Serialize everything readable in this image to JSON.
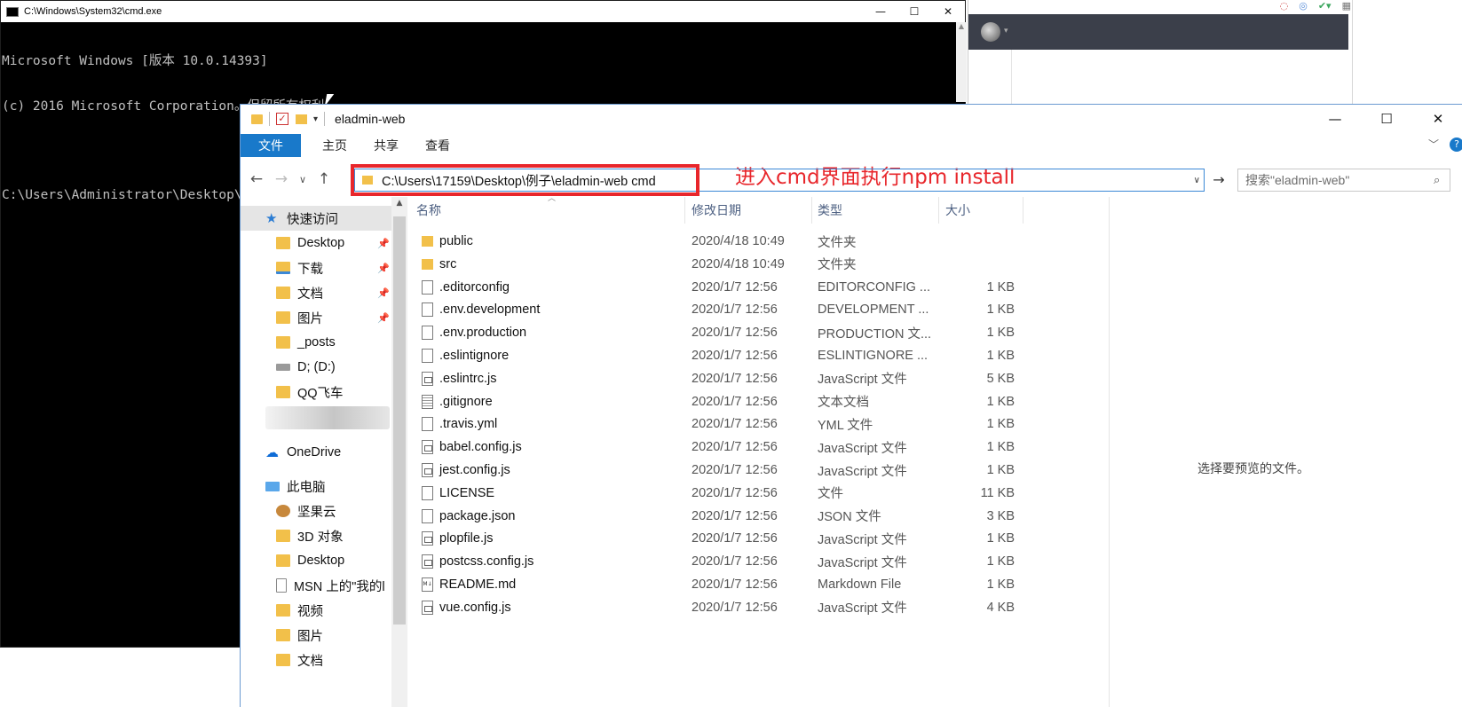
{
  "cmd": {
    "title": "C:\\Windows\\System32\\cmd.exe",
    "lines": [
      "Microsoft Windows [版本 10.0.14393]",
      "(c) 2016 Microsoft Corporation。保留所有权利。",
      "C:\\Users\\Administrator\\Desktop\\直播笔记\\项目\\eladmin-web>npm install"
    ],
    "controls": {
      "minimize": "—",
      "maximize": "☐",
      "close": "✕"
    }
  },
  "explorer": {
    "title": "eladmin-web",
    "controls": {
      "minimize": "—",
      "maximize": "☐",
      "close": "✕"
    },
    "ribbon": {
      "file": "文件",
      "tabs": [
        "主页",
        "共享",
        "查看"
      ]
    },
    "annotation": "进入cmd界面执行npm install",
    "address": "C:\\Users\\17159\\Desktop\\例子\\eladmin-web cmd",
    "search_placeholder": "搜索\"eladmin-web\"",
    "nav": [
      {
        "label": "快速访问",
        "icon": "star-icon",
        "pinned": false
      },
      {
        "label": "Desktop",
        "icon": "folder-icon",
        "pinned": true
      },
      {
        "label": "下载",
        "icon": "download-folder-icon",
        "pinned": true
      },
      {
        "label": "文档",
        "icon": "documents-folder-icon",
        "pinned": true
      },
      {
        "label": "图片",
        "icon": "pictures-folder-icon",
        "pinned": true
      },
      {
        "label": "_posts",
        "icon": "folder-icon",
        "pinned": false
      },
      {
        "label": "D; (D:)",
        "icon": "drive-icon",
        "pinned": false
      },
      {
        "label": "QQ飞车",
        "icon": "folder-icon",
        "pinned": false
      },
      {
        "label": "OneDrive",
        "icon": "onedrive-cloud-icon",
        "pinned": false
      },
      {
        "label": "此电脑",
        "icon": "this-pc-icon",
        "pinned": false
      },
      {
        "label": "坚果云",
        "icon": "nutstore-icon",
        "pinned": false
      },
      {
        "label": "3D 对象",
        "icon": "3d-objects-folder-icon",
        "pinned": false
      },
      {
        "label": "Desktop",
        "icon": "folder-icon",
        "pinned": false
      },
      {
        "label": "MSN 上的\"我的l",
        "icon": "document-icon",
        "pinned": false
      },
      {
        "label": "视频",
        "icon": "videos-folder-icon",
        "pinned": false
      },
      {
        "label": "图片",
        "icon": "pictures-folder-icon",
        "pinned": false
      },
      {
        "label": "文档",
        "icon": "documents-folder-icon",
        "pinned": false
      }
    ],
    "columns": {
      "name": "名称",
      "date": "修改日期",
      "type": "类型",
      "size": "大小"
    },
    "files": [
      {
        "name": "public",
        "date": "2020/4/18 10:49",
        "type": "文件夹",
        "size": "",
        "icon": "folder"
      },
      {
        "name": "src",
        "date": "2020/4/18 10:49",
        "type": "文件夹",
        "size": "",
        "icon": "folder"
      },
      {
        "name": ".editorconfig",
        "date": "2020/1/7 12:56",
        "type": "EDITORCONFIG ...",
        "size": "1 KB",
        "icon": "file"
      },
      {
        "name": ".env.development",
        "date": "2020/1/7 12:56",
        "type": "DEVELOPMENT ...",
        "size": "1 KB",
        "icon": "file"
      },
      {
        "name": ".env.production",
        "date": "2020/1/7 12:56",
        "type": "PRODUCTION 文...",
        "size": "1 KB",
        "icon": "file"
      },
      {
        "name": ".eslintignore",
        "date": "2020/1/7 12:56",
        "type": "ESLINTIGNORE ...",
        "size": "1 KB",
        "icon": "file"
      },
      {
        "name": ".eslintrc.js",
        "date": "2020/1/7 12:56",
        "type": "JavaScript 文件",
        "size": "5 KB",
        "icon": "js"
      },
      {
        "name": ".gitignore",
        "date": "2020/1/7 12:56",
        "type": "文本文档",
        "size": "1 KB",
        "icon": "txt"
      },
      {
        "name": ".travis.yml",
        "date": "2020/1/7 12:56",
        "type": "YML 文件",
        "size": "1 KB",
        "icon": "file"
      },
      {
        "name": "babel.config.js",
        "date": "2020/1/7 12:56",
        "type": "JavaScript 文件",
        "size": "1 KB",
        "icon": "js"
      },
      {
        "name": "jest.config.js",
        "date": "2020/1/7 12:56",
        "type": "JavaScript 文件",
        "size": "1 KB",
        "icon": "js"
      },
      {
        "name": "LICENSE",
        "date": "2020/1/7 12:56",
        "type": "文件",
        "size": "11 KB",
        "icon": "file"
      },
      {
        "name": "package.json",
        "date": "2020/1/7 12:56",
        "type": "JSON 文件",
        "size": "3 KB",
        "icon": "file"
      },
      {
        "name": "plopfile.js",
        "date": "2020/1/7 12:56",
        "type": "JavaScript 文件",
        "size": "1 KB",
        "icon": "js"
      },
      {
        "name": "postcss.config.js",
        "date": "2020/1/7 12:56",
        "type": "JavaScript 文件",
        "size": "1 KB",
        "icon": "js"
      },
      {
        "name": "README.md",
        "date": "2020/1/7 12:56",
        "type": "Markdown File",
        "size": "1 KB",
        "icon": "md"
      },
      {
        "name": "vue.config.js",
        "date": "2020/1/7 12:56",
        "type": "JavaScript 文件",
        "size": "4 KB",
        "icon": "js"
      }
    ],
    "preview_text": "选择要预览的文件。"
  },
  "colors": {
    "annotation_red": "#e8262b",
    "file_tab_blue": "#1979ca",
    "folder_yellow": "#f2c04a"
  }
}
